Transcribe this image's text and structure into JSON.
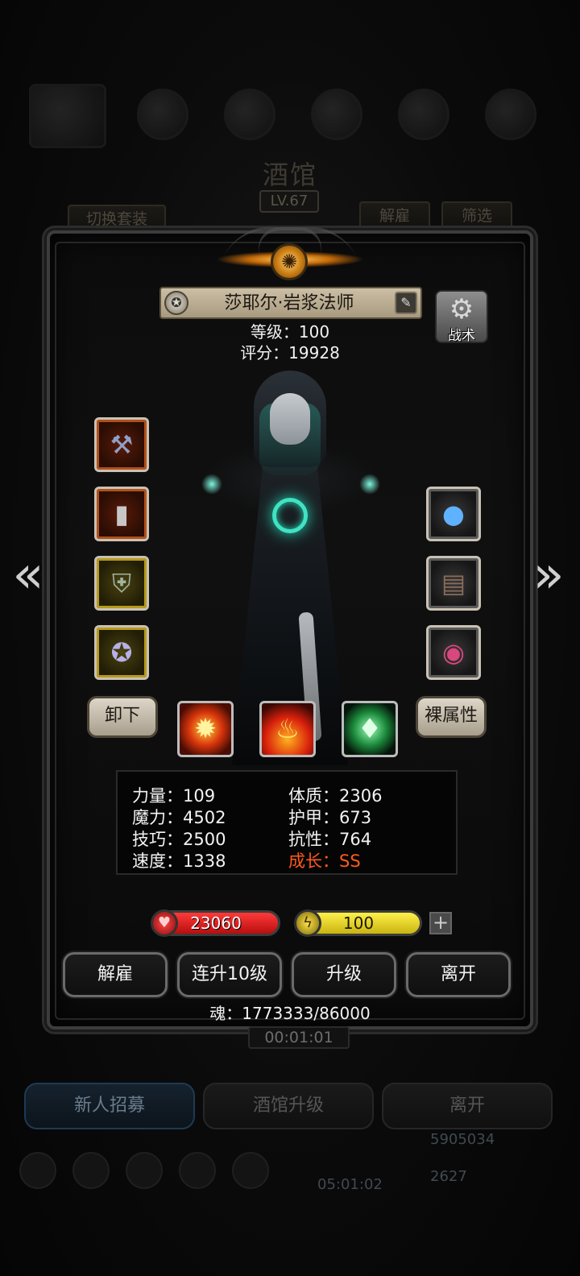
{
  "background": {
    "title": "酒馆",
    "level": "LV.67",
    "switch_outfit": "切换套装",
    "dismiss": "解雇",
    "filter": "筛选",
    "timer": "00:01:01",
    "tabs": [
      {
        "label": "新人招募",
        "active": true
      },
      {
        "label": "酒馆升级",
        "active": false
      },
      {
        "label": "离开",
        "active": false
      }
    ],
    "gold": "5905034",
    "gem": "2627",
    "bottom_timer": "05:01:02"
  },
  "hero": {
    "name": "莎耶尔·岩浆法师",
    "level_text": "等级：100",
    "score_text": "评分：19928",
    "tactics_label": "战术",
    "unequip_label": "卸下",
    "naked_attr_label": "裸属性"
  },
  "equipment_left": [
    {
      "icon": "scythe-weapon-icon",
      "rarity": "red"
    },
    {
      "icon": "armor-gauntlet-icon",
      "rarity": "red"
    },
    {
      "icon": "shield-icon",
      "rarity": "gold"
    },
    {
      "icon": "pentagram-amulet-icon",
      "rarity": "gold"
    }
  ],
  "equipment_right": [
    {
      "icon": "crystal-orb-icon",
      "rarity": "plain"
    },
    {
      "icon": "spellbook-icon",
      "rarity": "plain"
    },
    {
      "icon": "eye-relic-icon",
      "rarity": "plain"
    }
  ],
  "skills": [
    {
      "icon": "fire-burst-icon"
    },
    {
      "icon": "flame-icon"
    },
    {
      "icon": "green-crystal-icon"
    }
  ],
  "attributes": {
    "strength": "力量：109",
    "constitution": "体质：2306",
    "magic": "魔力：4502",
    "armor": "护甲：673",
    "skill": "技巧：2500",
    "resistance": "抗性：764",
    "speed": "速度：1338",
    "growth": "成长：SS"
  },
  "bars": {
    "hp": "23060",
    "energy": "100"
  },
  "actions": {
    "dismiss": "解雇",
    "upgrade10": "连升10级",
    "upgrade": "升级",
    "leave": "离开"
  },
  "soul_text": "魂：1773333/86000",
  "colors": {
    "growth": "#ff5a1a",
    "hp_bar": "#d11a1a",
    "energy_bar": "#e6d21e",
    "name_bar": "#bdb094"
  }
}
